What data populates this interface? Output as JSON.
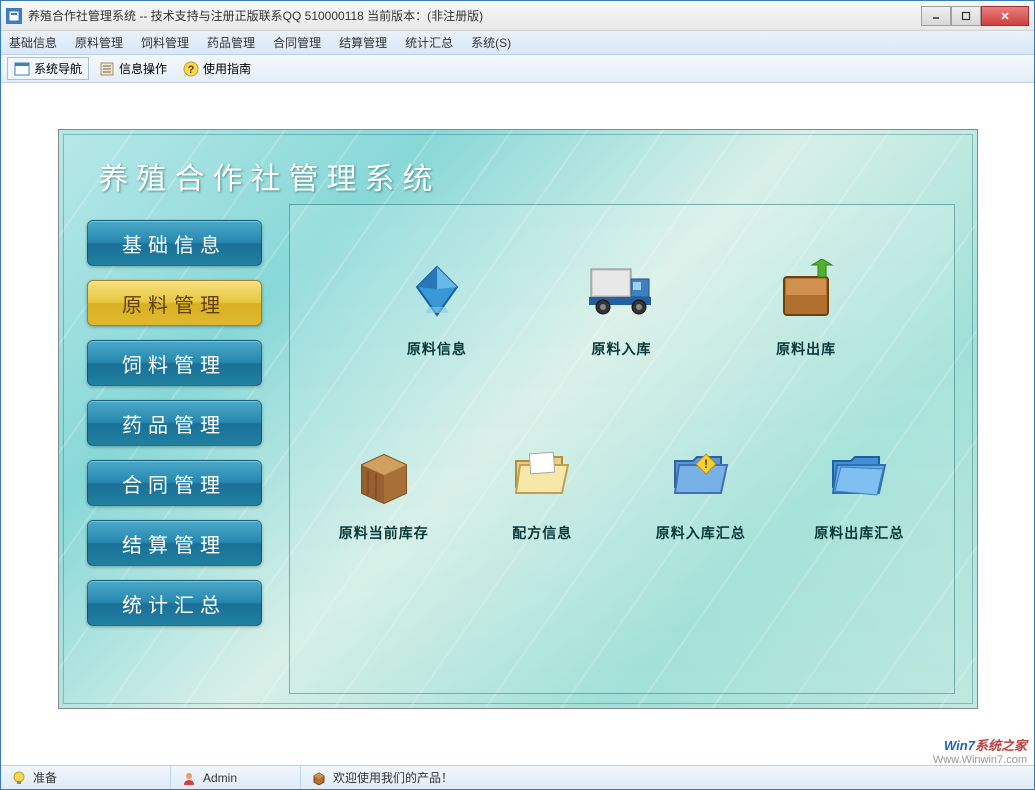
{
  "titlebar": {
    "text": "养殖合作社管理系统 -- 技术支持与注册正版联系QQ 510000118    当前版本：(非注册版)"
  },
  "menu": {
    "items": [
      "基础信息",
      "原料管理",
      "饲料管理",
      "药品管理",
      "合同管理",
      "结算管理",
      "统计汇总",
      "系统(S)"
    ]
  },
  "toolbar": {
    "items": [
      {
        "label": "系统导航",
        "icon": "window-icon"
      },
      {
        "label": "信息操作",
        "icon": "list-icon"
      },
      {
        "label": "使用指南",
        "icon": "help-icon"
      }
    ]
  },
  "dashboard": {
    "title": "养殖合作社管理系统",
    "nav": [
      {
        "label": "基础信息",
        "active": false
      },
      {
        "label": "原料管理",
        "active": true
      },
      {
        "label": "饲料管理",
        "active": false
      },
      {
        "label": "药品管理",
        "active": false
      },
      {
        "label": "合同管理",
        "active": false
      },
      {
        "label": "结算管理",
        "active": false
      },
      {
        "label": "统计汇总",
        "active": false
      }
    ],
    "icons_row1": [
      {
        "label": "原料信息",
        "icon": "diamond-icon"
      },
      {
        "label": "原料入库",
        "icon": "truck-icon"
      },
      {
        "label": "原料出库",
        "icon": "box-out-icon"
      }
    ],
    "icons_row2": [
      {
        "label": "原料当前库存",
        "icon": "crate-icon"
      },
      {
        "label": "配方信息",
        "icon": "folder-icon"
      },
      {
        "label": "原料入库汇总",
        "icon": "folder-warn-icon"
      },
      {
        "label": "原料出库汇总",
        "icon": "folder-blue-icon"
      }
    ]
  },
  "status": {
    "ready": "准备",
    "user": "Admin",
    "message": "欢迎使用我们的产品！"
  },
  "watermark": {
    "line1_a": "Win7",
    "line1_b": "系统之家",
    "line2": "Www.Winwin7.com"
  }
}
